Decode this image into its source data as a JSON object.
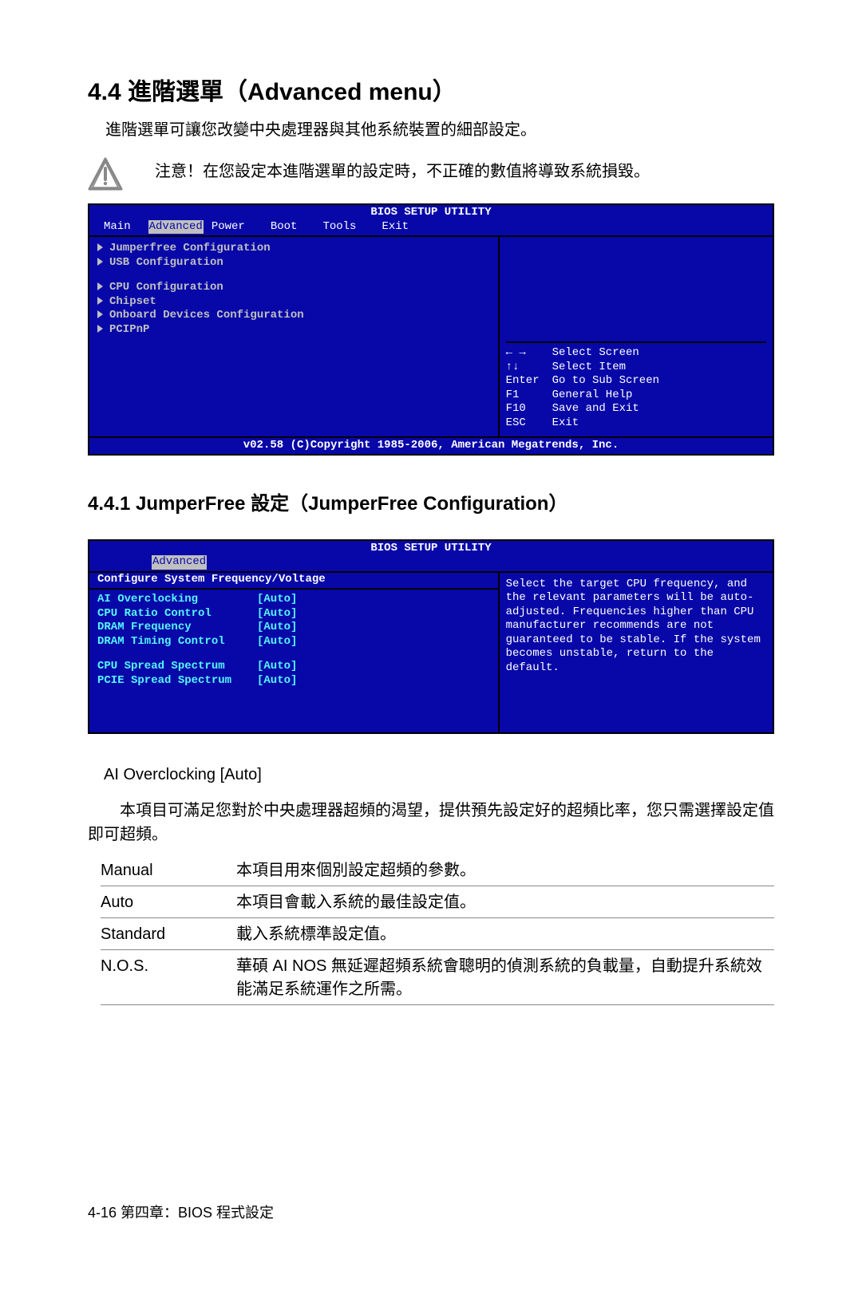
{
  "heading": "4.4 進階選單（Advanced menu）",
  "intro": "進階選單可讓您改變中央處理器與其他系統裝置的細部設定。",
  "warning": "注意！在您設定本進階選單的設定時，不正確的數值將導致系統損毀。",
  "bios1": {
    "title": "BIOS SETUP UTILITY",
    "tabs": [
      "Main",
      "Advanced",
      "Power",
      "Boot",
      "Tools",
      "Exit"
    ],
    "active_tab": "Advanced",
    "menu_group1": [
      "Jumperfree Configuration",
      "USB Configuration"
    ],
    "menu_group2": [
      "CPU Configuration",
      "Chipset",
      "Onboard Devices Configuration",
      "PCIPnP"
    ],
    "help": [
      {
        "key": "← →",
        "text": "Select Screen"
      },
      {
        "key": "↑↓",
        "text": "Select Item"
      },
      {
        "key": "Enter",
        "text": "Go to Sub Screen"
      },
      {
        "key": "F1",
        "text": "General Help"
      },
      {
        "key": "F10",
        "text": "Save and Exit"
      },
      {
        "key": "ESC",
        "text": "Exit"
      }
    ],
    "footer": "v02.58 (C)Copyright 1985-2006, American Megatrends, Inc."
  },
  "subsection": "4.4.1 JumperFree 設定（JumperFree Configuration）",
  "bios2": {
    "title": "BIOS SETUP UTILITY",
    "active_tab": "Advanced",
    "cfg_header": "Configure System Frequency/Voltage",
    "rows": [
      {
        "label": "AI Overclocking",
        "val": "[Auto]"
      },
      {
        "label": "CPU Ratio Control",
        "val": "[Auto]"
      },
      {
        "label": "DRAM Frequency",
        "val": "[Auto]"
      },
      {
        "label": "DRAM Timing Control",
        "val": "[Auto]"
      }
    ],
    "rows2": [
      {
        "label": "CPU Spread Spectrum",
        "val": "[Auto]"
      },
      {
        "label": "PCIE Spread Spectrum",
        "val": "[Auto]"
      }
    ],
    "help_text": "Select the target CPU frequency, and the relevant parameters will be auto-adjusted. Frequencies higher than CPU manufacturer recommends are not guaranteed to be stable. If the system becomes unstable, return to the default."
  },
  "item_title": "AI Overclocking [Auto]",
  "item_desc": "本項目可滿足您對於中央處理器超頻的渴望，提供預先設定好的超頻比率，您只需選擇設定值即可超頻。",
  "options": [
    {
      "key": "Manual",
      "val": "本項目用來個別設定超頻的參數。"
    },
    {
      "key": "Auto",
      "val": "本項目會載入系統的最佳設定值。"
    },
    {
      "key": "Standard",
      "val": "載入系統標準設定值。"
    },
    {
      "key": "N.O.S.",
      "val": "華碩 AI NOS 無延遲超頻系統會聰明的偵測系統的負載量，自動提升系統效能滿足系統運作之所需。"
    }
  ],
  "footer": "4-16  第四章：BIOS 程式設定"
}
